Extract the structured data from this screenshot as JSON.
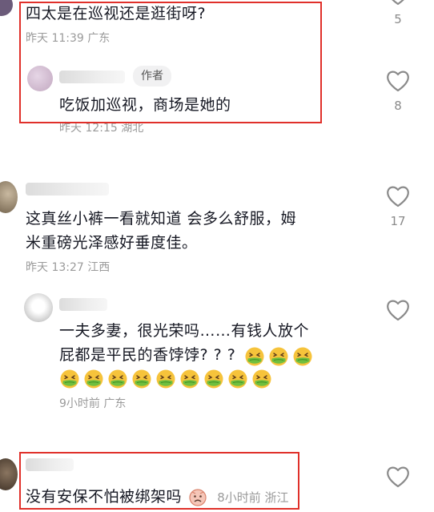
{
  "comments": [
    {
      "text": "四太是在巡视还是逛街呀?",
      "meta": "昨天 11:39 广东",
      "likes": "5",
      "reply": {
        "badge": "作者",
        "text": "吃饭加巡视，商场是她的",
        "meta": "昨天 12:15 湖北",
        "likes": "8"
      }
    },
    {
      "text_line1": "这真丝小裤一看就知道 会多么舒服，姆",
      "text_line2": "米重磅光泽感好垂度佳。",
      "meta": "昨天 13:27 江西",
      "likes": "17",
      "reply": {
        "text_line1": "一夫多妻，很光荣吗……有钱人放个",
        "text_line2": "屁都是平民的香饽饽? ? ?",
        "meta": "9小时前  广东",
        "emoji_count_line2": 3,
        "emoji_count_line3": 9,
        "emoji_name": "nauseated-face-emoji"
      }
    },
    {
      "text": "没有安保不怕被绑架吗",
      "meta": "8小时前  浙江",
      "emoji_name": "sad-face-emoji"
    }
  ],
  "colors": {
    "highlight_box": "#e0302a",
    "meta_gray": "#9a9a9a",
    "text": "#161823"
  }
}
